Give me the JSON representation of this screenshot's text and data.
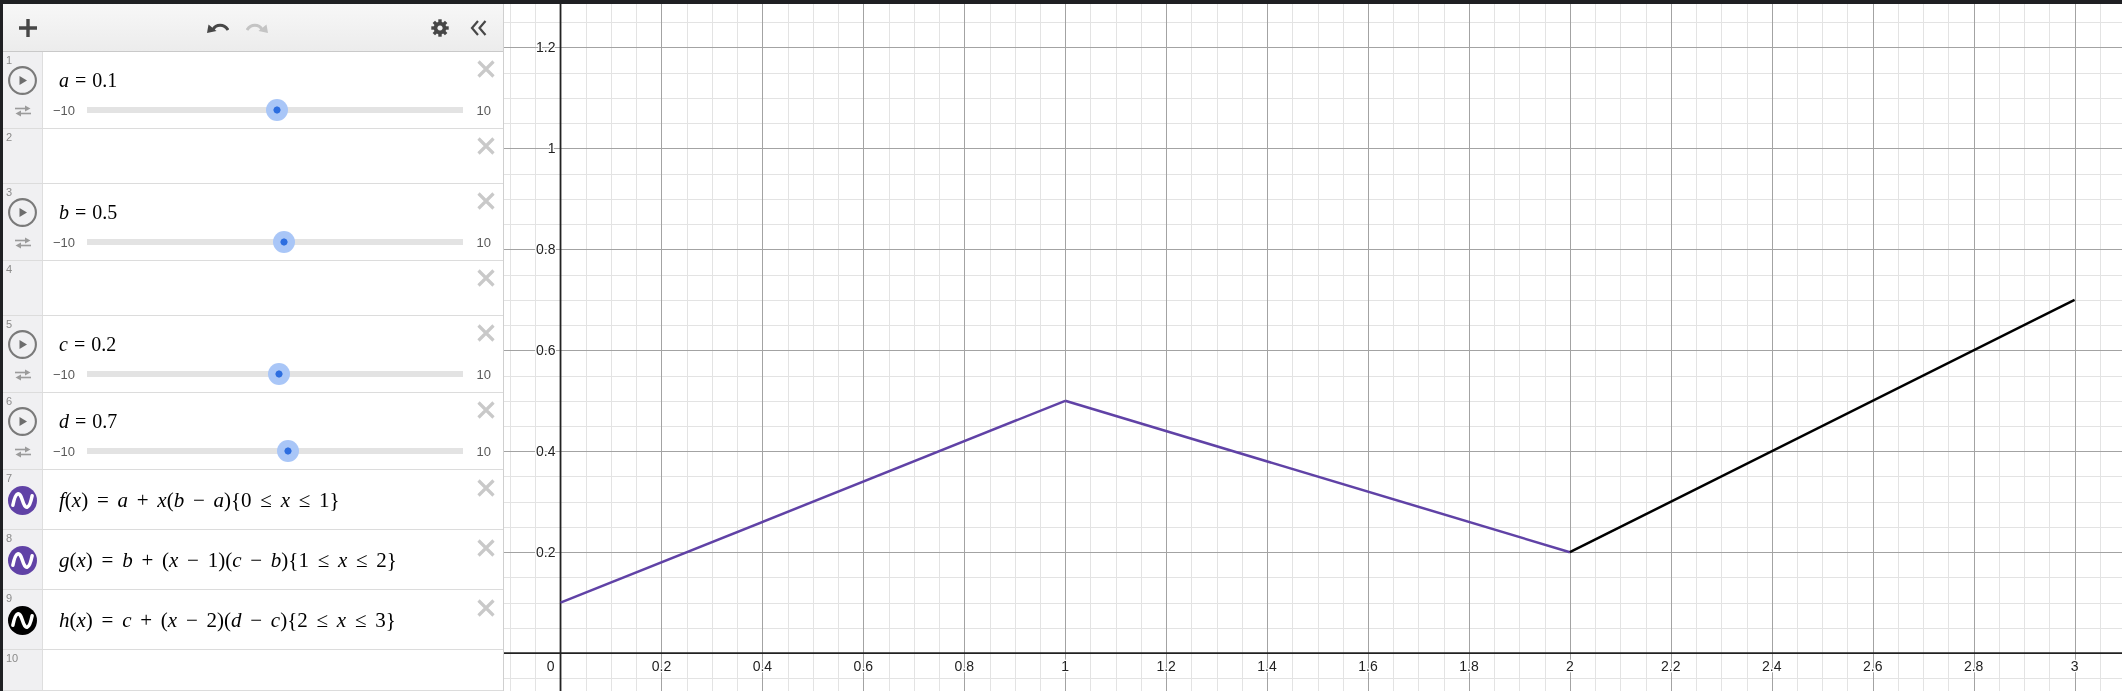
{
  "toolbar": [
    {
      "kind": "add",
      "disabled": false
    },
    {
      "kind": "undo",
      "disabled": false
    },
    {
      "kind": "redo",
      "disabled": true
    },
    {
      "kind": "settings",
      "disabled": false
    },
    {
      "kind": "collapse",
      "disabled": false
    }
  ],
  "expressions": [
    {
      "kind": "slider",
      "number": "1",
      "expression": "*a* = 0.1",
      "deletable": true,
      "slider": {
        "min": "−10",
        "max": "10",
        "level": 0.505
      }
    },
    {
      "kind": "empty",
      "number": "2",
      "deletable": true
    },
    {
      "kind": "slider",
      "number": "3",
      "expression": "*b* = 0.5",
      "deletable": true,
      "slider": {
        "min": "−10",
        "max": "10",
        "level": 0.525
      }
    },
    {
      "kind": "empty",
      "number": "4",
      "deletable": true
    },
    {
      "kind": "slider",
      "number": "5",
      "expression": "*c* = 0.2",
      "deletable": true,
      "slider": {
        "min": "−10",
        "max": "10",
        "level": 0.51
      }
    },
    {
      "kind": "slider",
      "number": "6",
      "expression": "*d* = 0.7",
      "deletable": true,
      "slider": {
        "min": "−10",
        "max": "10",
        "level": 0.535
      }
    },
    {
      "kind": "function",
      "number": "7",
      "expression": "*f*(*x*) = *a* + *x*(*b* − *a*){0 ≤ *x* ≤ 1}",
      "color": "#6042a6",
      "deletable": true
    },
    {
      "kind": "function",
      "number": "8",
      "expression": "*g*(*x*) = *b* + (*x* − 1)(*c* − *b*){1 ≤ *x* ≤ 2}",
      "color": "#6042a6",
      "deletable": true
    },
    {
      "kind": "function",
      "number": "9",
      "expression": "*h*(*x*) = *c* + (*x* − 2)(*d* − *c*){2 ≤ *x* ≤ 3}",
      "color": "#000000",
      "deletable": true
    },
    {
      "kind": "empty",
      "number": "10",
      "deletable": false
    }
  ],
  "graph": {
    "origin_label": "0",
    "chart_data": {
      "type": "line",
      "grid": true,
      "x": [
        0,
        1,
        2,
        3
      ],
      "series": [
        {
          "color": "#6042a6",
          "values": [
            0.1,
            0.5,
            null,
            null
          ]
        },
        {
          "color": "#6042a6",
          "values": [
            null,
            0.5,
            0.2,
            null
          ]
        },
        {
          "color": "#000000",
          "values": [
            null,
            null,
            0.2,
            0.7
          ]
        }
      ],
      "xlim": [
        -0.112,
        3.094
      ],
      "ylim": [
        -0.075,
        1.286
      ],
      "xticks": [
        0.2,
        0.4,
        0.6,
        0.8,
        1,
        1.2,
        1.4,
        1.6,
        1.8,
        2,
        2.2,
        2.4,
        2.6,
        2.8,
        3
      ],
      "yticks": [
        0.2,
        0.4,
        0.6,
        0.8,
        1,
        1.2
      ]
    }
  }
}
